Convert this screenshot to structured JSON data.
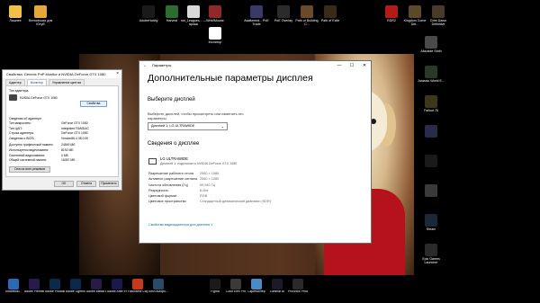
{
  "desktop": {
    "top_icons": [
      {
        "label": "Лишнее",
        "color": "#f0c04a"
      },
      {
        "label": "Фотосессия для Ютуб",
        "color": "#e6a83a"
      },
      {
        "label": "AdobeHobby",
        "color": "#1a1a1a"
      },
      {
        "label": "Harvest",
        "color": "#2b6e2f"
      },
      {
        "label": "run_Leagues... — ярлык",
        "color": "#d9d9d9"
      },
      {
        "label": "WoWMouse",
        "color": "#8f2a2a"
      },
      {
        "label": "Awakened... PoE Trade",
        "color": "#3a3a6a"
      },
      {
        "label": "PoE Overlay",
        "color": "#2b2b2b"
      },
      {
        "label": "Path of Building C...",
        "color": "#6a4a2a"
      },
      {
        "label": "Path of Exile",
        "color": "#3a2a1a"
      },
      {
        "label": "RDR2",
        "color": "#b51a1a"
      },
      {
        "label": "Kingdom Come Del...",
        "color": "#5a4a2a"
      },
      {
        "label": "Grim Dawn Definitive",
        "color": "#4a3a2a"
      }
    ],
    "monitor_icon": {
      "label": "Монитор",
      "color": "#ffffff"
    },
    "right_icons": [
      {
        "label": "Absolute Sloth",
        "color": "#4a4a4a"
      },
      {
        "label": "Jurassic World E...",
        "color": "#2a3a2a"
      },
      {
        "label": "Fallout 76",
        "color": "#3a3a1a"
      },
      {
        "label": "",
        "color": "#2a2a4a"
      },
      {
        "label": "",
        "color": "#1a1a1a"
      },
      {
        "label": "",
        "color": "#3a3a3a"
      },
      {
        "label": "Steam",
        "color": "#1b2838"
      },
      {
        "label": "Epic Games Launcher",
        "color": "#2a2a2a"
      }
    ],
    "bottom_icons": [
      {
        "label": "SmartMou...",
        "color": "#2a6ab5"
      },
      {
        "label": "Adobe Premiere P...",
        "color": "#2a1a4a"
      },
      {
        "label": "Adobe Photoshop...",
        "color": "#0a2a4a"
      },
      {
        "label": "Adobe Lightroo...",
        "color": "#0a2a4a"
      },
      {
        "label": "Adobe Media Encoder 2020",
        "color": "#2a1a4a"
      },
      {
        "label": "Adobe After Effects...",
        "color": "#1a1a4a"
      },
      {
        "label": "FastStone Capture",
        "color": "#c53a1a"
      },
      {
        "label": "Kelvi Autopo...",
        "color": "#2a4a6a"
      },
      {
        "label": "Figma",
        "color": "#1a1a1a"
      },
      {
        "label": "Color Efex Pro 4",
        "color": "#3a3a3a"
      },
      {
        "label": "Скриншотер",
        "color": "#4a8ac5"
      },
      {
        "label": "Luminar AI",
        "color": "#1a1a2a"
      },
      {
        "label": "ProShow Producer",
        "color": "#2a2a2a"
      }
    ]
  },
  "legacy_dialog": {
    "title": "Свойства: Generic PnP Monitor и NVIDIA GeForce GTX 1080",
    "close": "×",
    "tabs": [
      "Адаптер",
      "Монитор",
      "Управление цветом"
    ],
    "group_label": "Тип адаптера",
    "device_name": "NVIDIA GeForce GTX 1080",
    "properties_button": "Свойства",
    "info_heading": "Сведения об адаптере",
    "info_rows": [
      {
        "k": "Тип микросхем:",
        "v": "GeForce GTX 1080"
      },
      {
        "k": "Тип ЦАП:",
        "v": "Integrated RAMDAC"
      },
      {
        "k": "Строка адаптера:",
        "v": "GeForce GTX 1080"
      },
      {
        "k": "Сведения о BIOS:",
        "v": "Version86.4.38.0.90"
      }
    ],
    "memory_rows": [
      {
        "k": "Доступно графической памяти:",
        "v": "24549 МБ"
      },
      {
        "k": "Используется видеопамяти:",
        "v": "8192 МБ"
      },
      {
        "k": "Системной видеопамяти:",
        "v": "0 МБ"
      },
      {
        "k": "Общей системной памяти:",
        "v": "16357 МБ"
      }
    ],
    "list_modes_link": "Список всех режимов",
    "buttons": [
      "OK",
      "Отмена",
      "Применить"
    ]
  },
  "settings": {
    "window_title": "Параметры",
    "back": "←",
    "controls": [
      "—",
      "☐",
      "✕"
    ],
    "heading": "Дополнительные параметры дисплея",
    "choose_display": "Выберите дисплей",
    "choose_desc": "Выберите дисплей, чтобы просмотреть или изменить его параметры.",
    "dropdown_value": "Дисплей 1: LG ULTRAWIDE",
    "info_heading": "Сведения о дисплее",
    "monitor_name": "LG ULTRAWIDE",
    "monitor_sub": "Дисплей 1: подключен к NVIDIA GeForce GTX 1080",
    "rows": [
      {
        "k": "Разрешение рабочего стола",
        "v": "2560 × 1080"
      },
      {
        "k": "Активное разрешение сигнала",
        "v": "2560 × 1080"
      },
      {
        "k": "Частота обновления (Гц)",
        "v": "59,940 Гц"
      },
      {
        "k": "Разрядность",
        "v": "8-бит"
      },
      {
        "k": "Цветовой формат",
        "v": "RGB"
      },
      {
        "k": "Цветовое пространство",
        "v": "Стандартный динамический диапазон (SDR)"
      }
    ],
    "adapter_link": "Свойства видеоадаптера для дисплея 1"
  }
}
